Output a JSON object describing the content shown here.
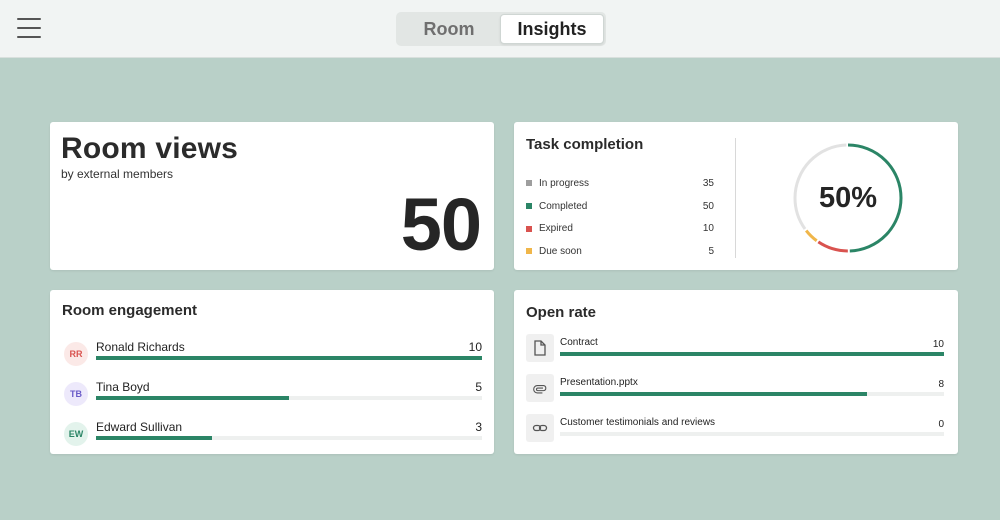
{
  "header": {
    "menu_icon": "hamburger-menu-icon",
    "tabs": [
      {
        "label": "Room",
        "active": false
      },
      {
        "label": "Insights",
        "active": true
      }
    ]
  },
  "room_views": {
    "title": "Room views",
    "subtitle": "by external members",
    "value": "50"
  },
  "task_completion": {
    "title": "Task completion",
    "percent_label": "50%",
    "items": [
      {
        "label": "In progress",
        "value": "35",
        "color": "#9e9e9e"
      },
      {
        "label": "Completed",
        "value": "50",
        "color": "#2b8566"
      },
      {
        "label": "Expired",
        "value": "10",
        "color": "#d9534f"
      },
      {
        "label": "Due soon",
        "value": "5",
        "color": "#f0b64a"
      }
    ]
  },
  "room_engagement": {
    "title": "Room engagement",
    "max": 10,
    "rows": [
      {
        "initials": "RR",
        "name": "Ronald Richards",
        "value": "10",
        "avatar_bg": "#fbe9e7",
        "avatar_fg": "#d9534f"
      },
      {
        "initials": "TB",
        "name": "Tina Boyd",
        "value": "5",
        "avatar_bg": "#ede9fb",
        "avatar_fg": "#6a5bc8"
      },
      {
        "initials": "EW",
        "name": "Edward Sullivan",
        "value": "3",
        "avatar_bg": "#e3f3ec",
        "avatar_fg": "#2b8566"
      }
    ]
  },
  "open_rate": {
    "title": "Open rate",
    "max": 10,
    "rows": [
      {
        "icon": "document-icon",
        "name": "Contract",
        "value": "10"
      },
      {
        "icon": "paperclip-icon",
        "name": "Presentation.pptx",
        "value": "8"
      },
      {
        "icon": "link-icon",
        "name": "Customer testimonials and reviews",
        "value": "0"
      }
    ]
  },
  "colors": {
    "accent": "#2b8566",
    "background": "#b9d0c8"
  }
}
